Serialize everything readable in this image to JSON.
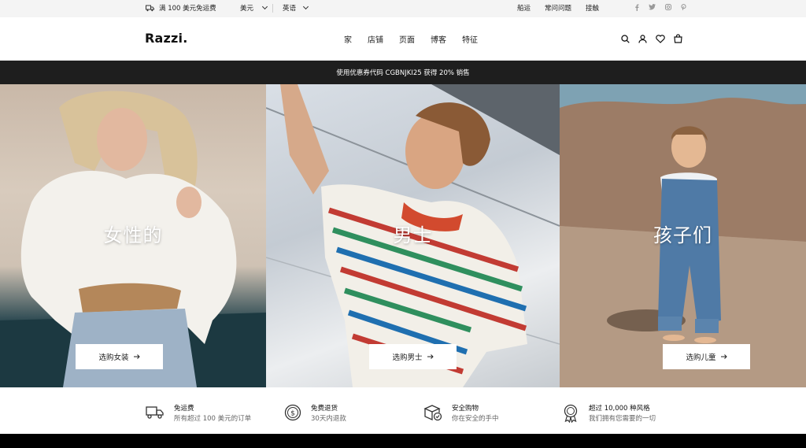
{
  "topbar": {
    "shipping": "满 100 美元免运费",
    "currency": "美元",
    "language": "英语",
    "links": [
      "船运",
      "常问问题",
      "接触"
    ],
    "social_icons": [
      "facebook-icon",
      "twitter-icon",
      "instagram-icon",
      "pinterest-icon"
    ]
  },
  "header": {
    "logo": "Razzi.",
    "nav": [
      "家",
      "店铺",
      "页面",
      "博客",
      "特征"
    ],
    "icons": [
      "search-icon",
      "account-icon",
      "wishlist-icon",
      "cart-icon"
    ]
  },
  "promo": {
    "text": "使用优惠券代码 CGBNJKI25 获得 20% 销售"
  },
  "categories": [
    {
      "title": "女性的",
      "button": "选购女装"
    },
    {
      "title": "男士",
      "button": "选购男士"
    },
    {
      "title": "孩子们",
      "button": "选购儿童"
    }
  ],
  "features": [
    {
      "icon": "truck-icon",
      "title": "免运费",
      "subtitle": "所有超过 100 美元的订单"
    },
    {
      "icon": "dollar-icon",
      "title": "免费退货",
      "subtitle": "30天内退款"
    },
    {
      "icon": "box-icon",
      "title": "安全购物",
      "subtitle": "你在安全的手中"
    },
    {
      "icon": "badge-icon",
      "title": "超过 10,000 种风格",
      "subtitle": "我们拥有您需要的一切"
    }
  ],
  "colors": {
    "promo_bg": "#1e1e1e",
    "topbar_bg": "#f4f4f4",
    "text": "#111111"
  }
}
